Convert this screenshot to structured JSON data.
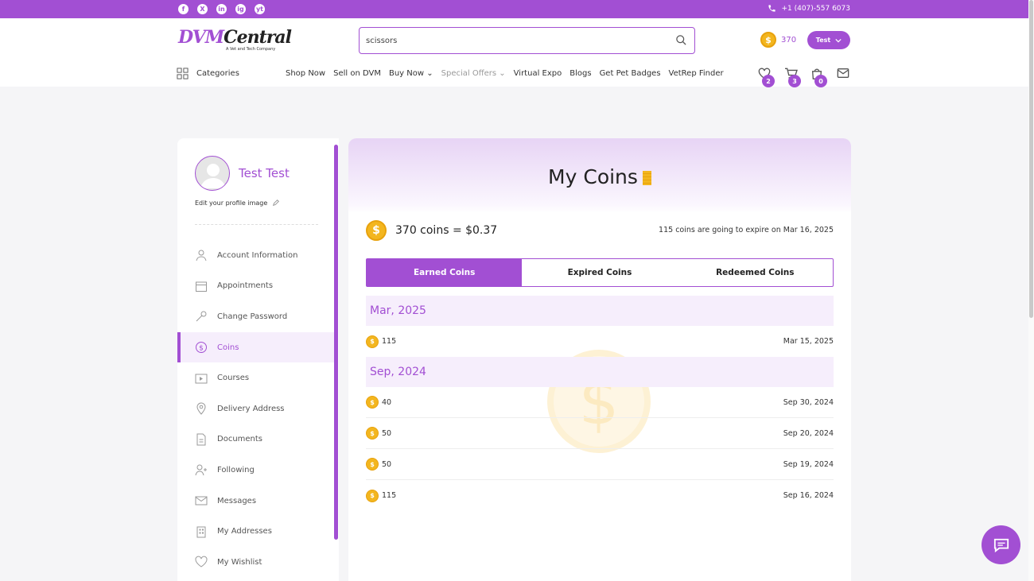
{
  "topbar": {
    "social": [
      "f",
      "X",
      "in",
      "ig",
      "yt"
    ],
    "phone": "+1 (407)-557 6073"
  },
  "header": {
    "logo_dvm": "DVM",
    "logo_central": "Central",
    "logo_tagline": "A Vet and Tech Company",
    "search_value": "scissors",
    "coins": "370",
    "user_label": "Test"
  },
  "nav": {
    "categories": "Categories",
    "links": [
      "Shop Now",
      "Sell on DVM",
      "Buy Now",
      "Special Offers",
      "Virtual Expo",
      "Blogs",
      "Get Pet Badges",
      "VetRep Finder"
    ],
    "wishlist_count": "2",
    "cart_count": "3",
    "bag_count": "0"
  },
  "sidebar": {
    "user_name": "Test Test",
    "edit_image": "Edit your profile image",
    "items": [
      "Account Information",
      "Appointments",
      "Change Password",
      "Coins",
      "Courses",
      "Delivery Address",
      "Documents",
      "Following",
      "Messages",
      "My Addresses",
      "My Wishlist"
    ],
    "active_item": "Coins"
  },
  "main": {
    "title": "My Coins",
    "summary": "370 coins = $0.37",
    "expire_note": "115 coins are going to expire on Mar 16, 2025",
    "tabs": [
      "Earned Coins",
      "Expired Coins",
      "Redeemed Coins"
    ],
    "active_tab": "Earned Coins",
    "groups": [
      {
        "month": "Mar, 2025",
        "rows": [
          {
            "amount": "115",
            "date": "Mar 15, 2025"
          }
        ]
      },
      {
        "month": "Sep, 2024",
        "rows": [
          {
            "amount": "40",
            "date": "Sep 30, 2024"
          },
          {
            "amount": "50",
            "date": "Sep 20, 2024"
          },
          {
            "amount": "50",
            "date": "Sep 19, 2024"
          },
          {
            "amount": "115",
            "date": "Sep 16, 2024"
          }
        ]
      }
    ]
  },
  "colors": {
    "accent": "#a24fd3",
    "coin": "#f3b61f",
    "tint": "#f6eefc"
  }
}
